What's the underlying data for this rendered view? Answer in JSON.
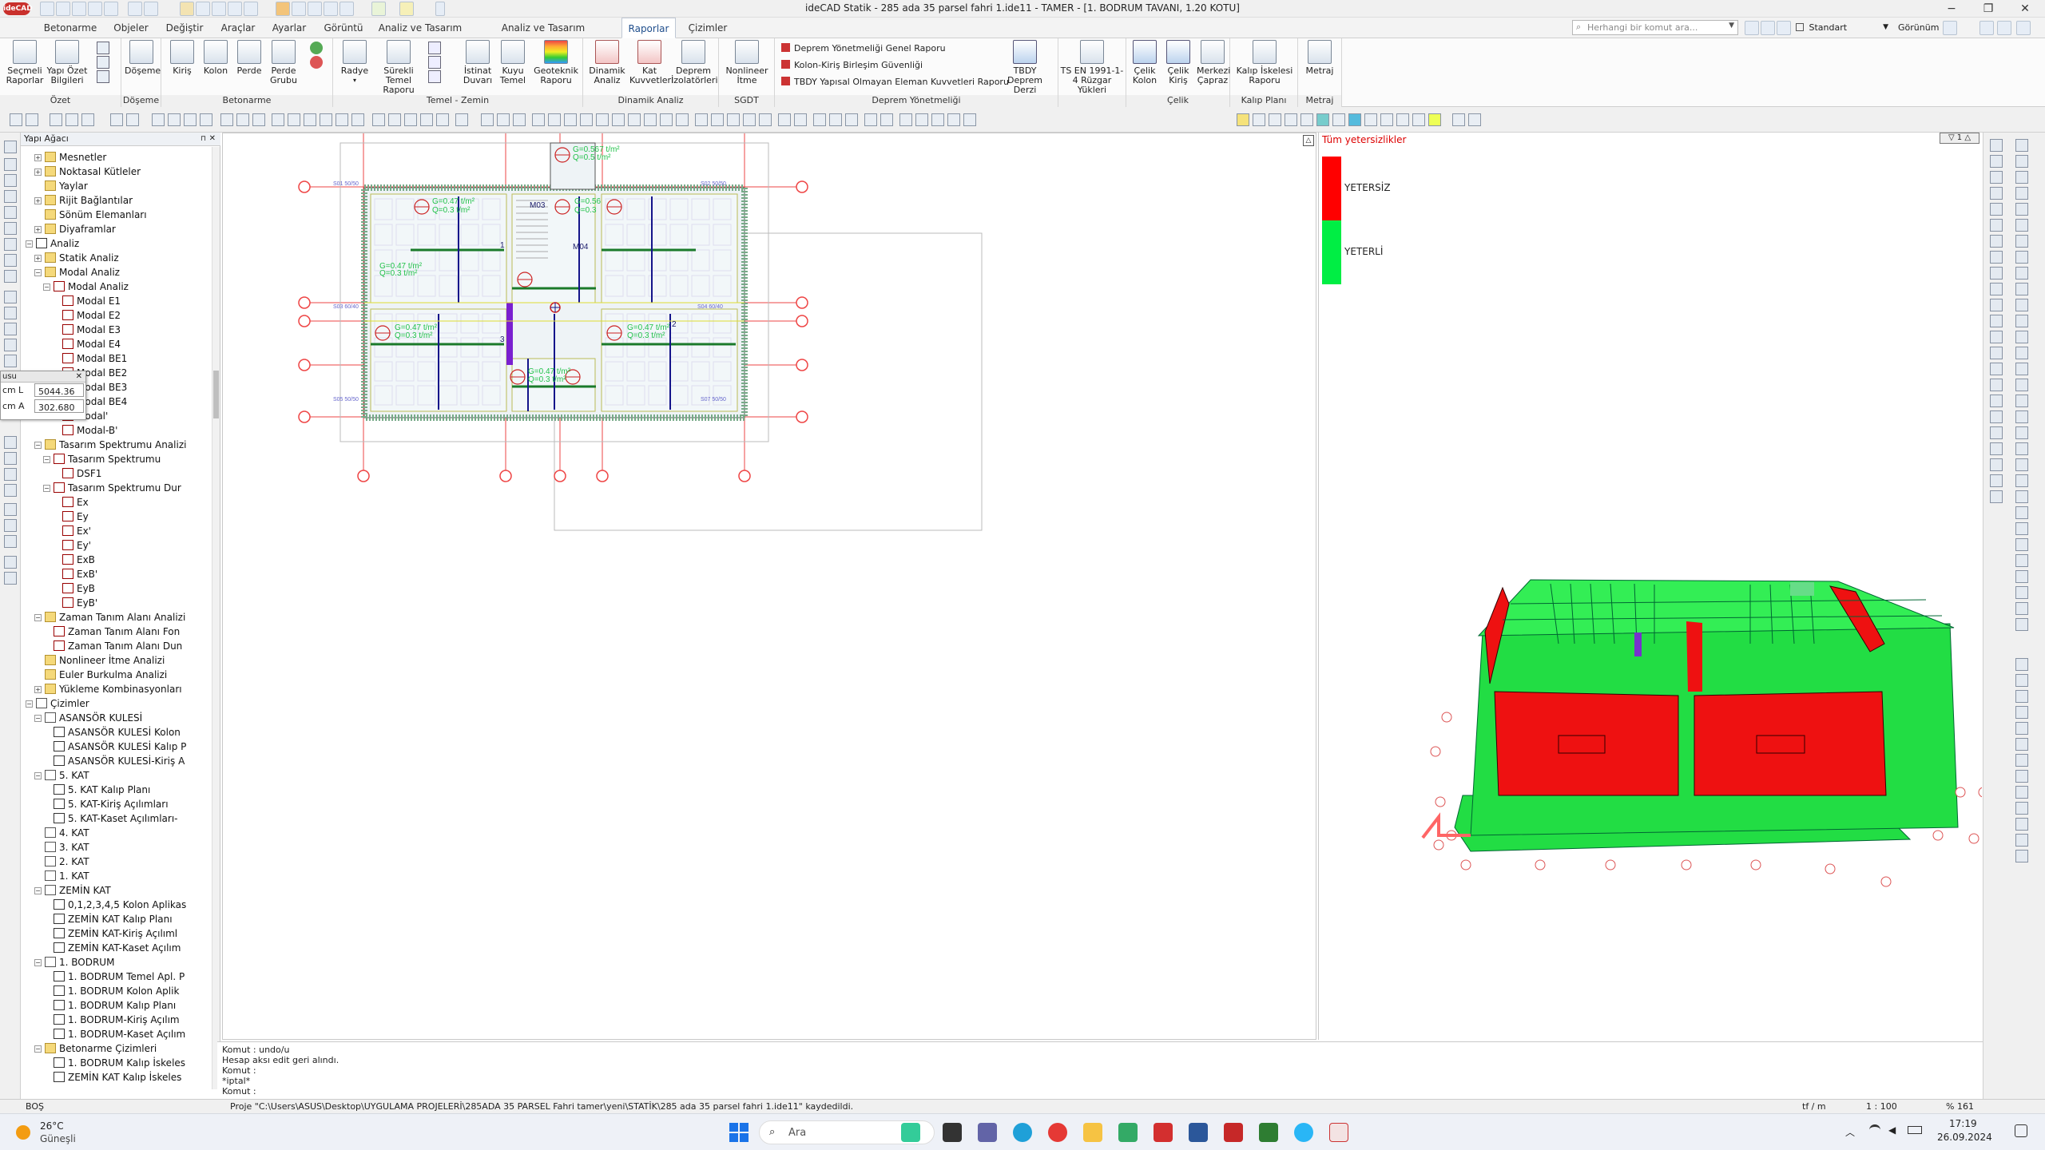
{
  "window": {
    "title": "ideCAD Statik - 285 ada 35 parsel fahri 1.ide11 - TAMER - [1. BODRUM TAVANI, 1.20 KOTU]"
  },
  "search": {
    "placeholder": "Herhangi bir komut ara..."
  },
  "view_style": "Standart",
  "view_menu": "Görünüm",
  "menu_tabs": [
    "Betonarme",
    "Objeler",
    "Değiştir",
    "Araçlar",
    "Ayarlar",
    "Görüntü",
    "Analiz ve Tasarım",
    "Analiz ve Tasarım Görüntüleme",
    "Raporlar",
    "Çizimler"
  ],
  "active_tab": "Raporlar",
  "ribbon": {
    "groups": [
      {
        "label": "Özet",
        "buttons": [
          "Seçmeli Raporlar",
          "Yapı Özet Bilgileri"
        ]
      },
      {
        "label": "Döşeme",
        "buttons": [
          "Döşeme"
        ]
      },
      {
        "label": "Betonarme",
        "buttons": [
          "Kiriş",
          "Kolon",
          "Perde",
          "Perde Grubu"
        ]
      },
      {
        "label": "Temel - Zemin",
        "buttons": [
          "Radye",
          "Sürekli Temel Raporu",
          "İstinat Duvarı",
          "Kuyu Temel",
          "Geoteknik Raporu"
        ]
      },
      {
        "label": "Dinamik Analiz",
        "buttons": [
          "Dinamik Analiz",
          "Kat Kuvvetleri",
          "Deprem İzolatörleri"
        ]
      },
      {
        "label": "SGDT",
        "buttons": [
          "Nonlineer İtme"
        ]
      },
      {
        "label": "Deprem Yönetmeliği",
        "links": [
          "Deprem Yönetmeliği Genel Raporu",
          "Kolon-Kiriş Birleşim Güvenliği",
          "TBDY Yapısal Olmayan Eleman Kuvvetleri Raporu"
        ],
        "buttons": [
          "TBDY Deprem Derzi"
        ]
      },
      {
        "label": "",
        "buttons": [
          "TS EN 1991-1-4 Rüzgar Yükleri"
        ]
      },
      {
        "label": "Çelik",
        "buttons": [
          "Çelik Kolon",
          "Çelik Kiriş",
          "Merkezi Çapraz"
        ]
      },
      {
        "label": "Kalıp Planı",
        "buttons": [
          "Kalıp İskelesi Raporu"
        ]
      },
      {
        "label": "Metraj",
        "buttons": [
          "Metraj"
        ]
      }
    ]
  },
  "tree": {
    "header": "Yapı Ağacı",
    "items": [
      {
        "label": "Mesnetler",
        "level": 2,
        "icon": "folder",
        "exp": "+"
      },
      {
        "label": "Noktasal Kütleler",
        "level": 2,
        "icon": "folder",
        "exp": "+"
      },
      {
        "label": "Yaylar",
        "level": 2,
        "icon": "folder",
        "exp": ""
      },
      {
        "label": "Rijit Bağlantılar",
        "level": 2,
        "icon": "folder",
        "exp": "+"
      },
      {
        "label": "Sönüm Elemanları",
        "level": 2,
        "icon": "folder",
        "exp": ""
      },
      {
        "label": "Diyaframlar",
        "level": 2,
        "icon": "folder",
        "exp": "+"
      },
      {
        "label": "Analiz",
        "level": 1,
        "icon": "sheet",
        "exp": "−"
      },
      {
        "label": "Statik Analiz",
        "level": 2,
        "icon": "folder",
        "exp": "+"
      },
      {
        "label": "Modal Analiz",
        "level": 2,
        "icon": "folder",
        "exp": "−"
      },
      {
        "label": "Modal Analiz",
        "level": 3,
        "icon": "chart",
        "exp": "−"
      },
      {
        "label": "Modal E1",
        "level": 4,
        "icon": "chart",
        "exp": ""
      },
      {
        "label": "Modal E2",
        "level": 4,
        "icon": "chart",
        "exp": ""
      },
      {
        "label": "Modal E3",
        "level": 4,
        "icon": "chart",
        "exp": ""
      },
      {
        "label": "Modal E4",
        "level": 4,
        "icon": "chart",
        "exp": ""
      },
      {
        "label": "Modal BE1",
        "level": 4,
        "icon": "chart",
        "exp": ""
      },
      {
        "label": "Modal BE2",
        "level": 4,
        "icon": "chart",
        "exp": ""
      },
      {
        "label": "Modal BE3",
        "level": 4,
        "icon": "chart",
        "exp": ""
      },
      {
        "label": "Modal BE4",
        "level": 4,
        "icon": "chart",
        "exp": ""
      },
      {
        "label": "Modal'",
        "level": 4,
        "icon": "chart",
        "exp": ""
      },
      {
        "label": "Modal-B'",
        "level": 4,
        "icon": "chart",
        "exp": ""
      },
      {
        "label": "Tasarım Spektrumu Analizi",
        "level": 2,
        "icon": "folder",
        "exp": "−"
      },
      {
        "label": "Tasarım Spektrumu",
        "level": 3,
        "icon": "chart",
        "exp": "−"
      },
      {
        "label": "DSF1",
        "level": 4,
        "icon": "chart",
        "exp": ""
      },
      {
        "label": "Tasarım Spektrumu Dur",
        "level": 3,
        "icon": "chart",
        "exp": "−"
      },
      {
        "label": "Ex",
        "level": 4,
        "icon": "chart",
        "exp": ""
      },
      {
        "label": "Ey",
        "level": 4,
        "icon": "chart",
        "exp": ""
      },
      {
        "label": "Ex'",
        "level": 4,
        "icon": "chart",
        "exp": ""
      },
      {
        "label": "Ey'",
        "level": 4,
        "icon": "chart",
        "exp": ""
      },
      {
        "label": "ExB",
        "level": 4,
        "icon": "chart",
        "exp": ""
      },
      {
        "label": "ExB'",
        "level": 4,
        "icon": "chart",
        "exp": ""
      },
      {
        "label": "EyB",
        "level": 4,
        "icon": "chart",
        "exp": ""
      },
      {
        "label": "EyB'",
        "level": 4,
        "icon": "chart",
        "exp": ""
      },
      {
        "label": "Zaman Tanım Alanı Analizi",
        "level": 2,
        "icon": "folder",
        "exp": "−"
      },
      {
        "label": "Zaman Tanım Alanı Fon",
        "level": 3,
        "icon": "chart",
        "exp": ""
      },
      {
        "label": "Zaman Tanım Alanı Dun",
        "level": 3,
        "icon": "chart",
        "exp": ""
      },
      {
        "label": "Nonlineer İtme Analizi",
        "level": 2,
        "icon": "folder",
        "exp": ""
      },
      {
        "label": "Euler Burkulma Analizi",
        "level": 2,
        "icon": "folder",
        "exp": ""
      },
      {
        "label": "Yükleme Kombinasyonları",
        "level": 2,
        "icon": "folder",
        "exp": "+"
      },
      {
        "label": "Çizimler",
        "level": 1,
        "icon": "doc",
        "exp": "−"
      },
      {
        "label": "ASANSÖR KULESİ",
        "level": 2,
        "icon": "doc",
        "exp": "−"
      },
      {
        "label": "ASANSÖR KULESİ Kolon",
        "level": 3,
        "icon": "sheet",
        "exp": ""
      },
      {
        "label": "ASANSÖR KULESİ Kalıp P",
        "level": 3,
        "icon": "sheet",
        "exp": ""
      },
      {
        "label": "ASANSÖR KULESİ-Kiriş A",
        "level": 3,
        "icon": "sheet",
        "exp": ""
      },
      {
        "label": "5. KAT",
        "level": 2,
        "icon": "doc",
        "exp": "−"
      },
      {
        "label": "5. KAT Kalıp Planı",
        "level": 3,
        "icon": "sheet",
        "exp": ""
      },
      {
        "label": "5. KAT-Kiriş Açılımları",
        "level": 3,
        "icon": "sheet",
        "exp": ""
      },
      {
        "label": "5. KAT-Kaset Açılımları-",
        "level": 3,
        "icon": "sheet",
        "exp": ""
      },
      {
        "label": "4. KAT",
        "level": 2,
        "icon": "doc",
        "exp": ""
      },
      {
        "label": "3. KAT",
        "level": 2,
        "icon": "doc",
        "exp": ""
      },
      {
        "label": "2. KAT",
        "level": 2,
        "icon": "doc",
        "exp": ""
      },
      {
        "label": "1. KAT",
        "level": 2,
        "icon": "doc",
        "exp": ""
      },
      {
        "label": "ZEMİN KAT",
        "level": 2,
        "icon": "doc",
        "exp": "−"
      },
      {
        "label": "0,1,2,3,4,5 Kolon Aplikas",
        "level": 3,
        "icon": "sheet",
        "exp": ""
      },
      {
        "label": "ZEMİN KAT Kalıp Planı",
        "level": 3,
        "icon": "sheet",
        "exp": ""
      },
      {
        "label": "ZEMİN KAT-Kiriş Açılıml",
        "level": 3,
        "icon": "sheet",
        "exp": ""
      },
      {
        "label": "ZEMİN KAT-Kaset Açılım",
        "level": 3,
        "icon": "sheet",
        "exp": ""
      },
      {
        "label": "1. BODRUM",
        "level": 2,
        "icon": "doc",
        "exp": "−"
      },
      {
        "label": "1. BODRUM Temel Apl. P",
        "level": 3,
        "icon": "sheet",
        "exp": ""
      },
      {
        "label": "1. BODRUM Kolon Aplik",
        "level": 3,
        "icon": "sheet",
        "exp": ""
      },
      {
        "label": "1. BODRUM Kalıp Planı",
        "level": 3,
        "icon": "sheet",
        "exp": ""
      },
      {
        "label": "1. BODRUM-Kiriş Açılım",
        "level": 3,
        "icon": "sheet",
        "exp": ""
      },
      {
        "label": "1. BODRUM-Kaset Açılım",
        "level": 3,
        "icon": "sheet",
        "exp": ""
      },
      {
        "label": "Betonarme Çizimleri",
        "level": 2,
        "icon": "folder",
        "exp": "−"
      },
      {
        "label": "1. BODRUM Kalıp İskeles",
        "level": 3,
        "icon": "sheet",
        "exp": ""
      },
      {
        "label": "ZEMİN KAT Kalıp İskeles",
        "level": 3,
        "icon": "sheet",
        "exp": ""
      }
    ]
  },
  "props_panel": {
    "title": "usu",
    "l_label": "L",
    "l_value": "5044.36 cm",
    "a_label": "A",
    "a_value": "302.680",
    "unit1": "cm",
    "unit2": "cm"
  },
  "plan": {
    "slab_labels": [
      "G=0.47 t/m²",
      "Q=0.3 t/m²",
      "G=0.567 t/m²",
      "Q=0.5 t/m²",
      "G=0.56",
      "Q=0.3",
      "G=0.47 t/m²",
      "Q=0.3 t/m²",
      "G=0.47 t/m²",
      "Q=0.3 t/m²",
      "G=0.47 t/m²",
      "Q=0.3 t/m²",
      "G=0.47 t/m²",
      "Q=0.3 t/m²"
    ],
    "markers": [
      "M03",
      "M04",
      "1",
      "2",
      "3"
    ],
    "column_tags": [
      "S01 50/50",
      "S02 50/50",
      "S03 60/40",
      "S04 60/40",
      "S05 50/50",
      "S07 50/50"
    ]
  },
  "legend": {
    "title": "Tüm yetersizlikler",
    "items": [
      {
        "label": "YETERSİZ",
        "color": "#ff0000"
      },
      {
        "label": "YETERLİ",
        "color": "#00ee44"
      }
    ]
  },
  "command": {
    "lines": [
      "Komut : undo/u",
      "Hesap aksı edit geri alındı.",
      "Komut :",
      "*iptal*",
      "Komut :"
    ]
  },
  "status": {
    "mode": "BOŞ",
    "message": "Proje \"C:\\Users\\ASUS\\Desktop\\UYGULAMA PROJELERİ\\285ADA 35 PARSEL Fahri tamer\\yeni\\STATİK\\285 ada 35 parsel fahri 1.ide11\" kaydedildi.",
    "unit": "tf / m",
    "scale": "1 : 100",
    "zoom": "% 161"
  },
  "taskbar": {
    "weather_temp": "26°C",
    "weather_desc": "Güneşli",
    "search": "Ara",
    "time": "17:19",
    "date": "26.09.2024"
  }
}
